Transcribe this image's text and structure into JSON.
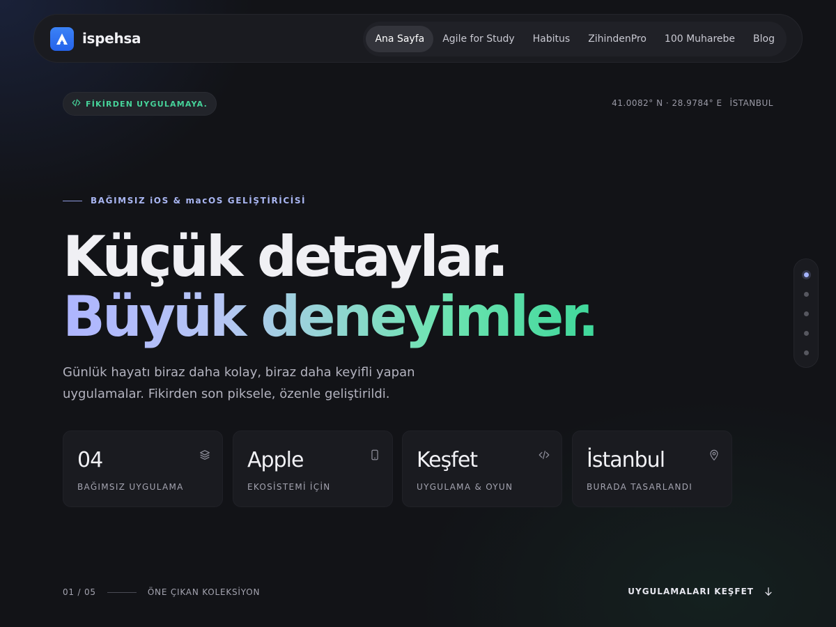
{
  "brand": {
    "name": "ispehsa",
    "accent": "#2563eb"
  },
  "nav": {
    "items": [
      {
        "label": "Ana Sayfa",
        "active": true
      },
      {
        "label": "Agile for Study"
      },
      {
        "label": "Habitus"
      },
      {
        "label": "ZihindenPro"
      },
      {
        "label": "100 Muharebe"
      },
      {
        "label": "Blog"
      }
    ]
  },
  "hero": {
    "tag": "FİKİRDEN UYGULAMAYA.",
    "coords": "41.0082° N · 28.9784° E",
    "city": "İSTANBUL",
    "eyebrow": "BAĞIMSIZ iOS & macOS GELİŞTİRİCİSİ",
    "title_line1": "Küçük detaylar.",
    "title_line2": "Büyük deneyimler.",
    "lead": "Günlük hayatı biraz daha kolay, biraz daha keyifli yapan uygulamalar. Fikirden son piksele, özenle geliştirildi."
  },
  "side_nav": {
    "count": 5,
    "active_index": 0
  },
  "stats": [
    {
      "value": "04",
      "label": "BAĞIMSIZ UYGULAMA",
      "icon": "layers-icon"
    },
    {
      "value": "Apple",
      "label": "EKOSİSTEMİ İÇİN",
      "icon": "phone-icon"
    },
    {
      "value": "Keşfet",
      "label": "UYGULAMA & OYUN",
      "icon": "code-icon"
    },
    {
      "value": "İstanbul",
      "label": "BURADA TASARLANDI",
      "icon": "location-pin-icon"
    }
  ],
  "footer": {
    "counter": "01 / 05",
    "collection": "ÖNE ÇIKAN KOLEKSİYON",
    "cta": "UYGULAMALARI KEŞFET"
  },
  "colors": {
    "background": "#121317",
    "tag_green": "#46d39a",
    "gradient_start": "#aeb5ff",
    "gradient_end": "#3fd79a"
  }
}
